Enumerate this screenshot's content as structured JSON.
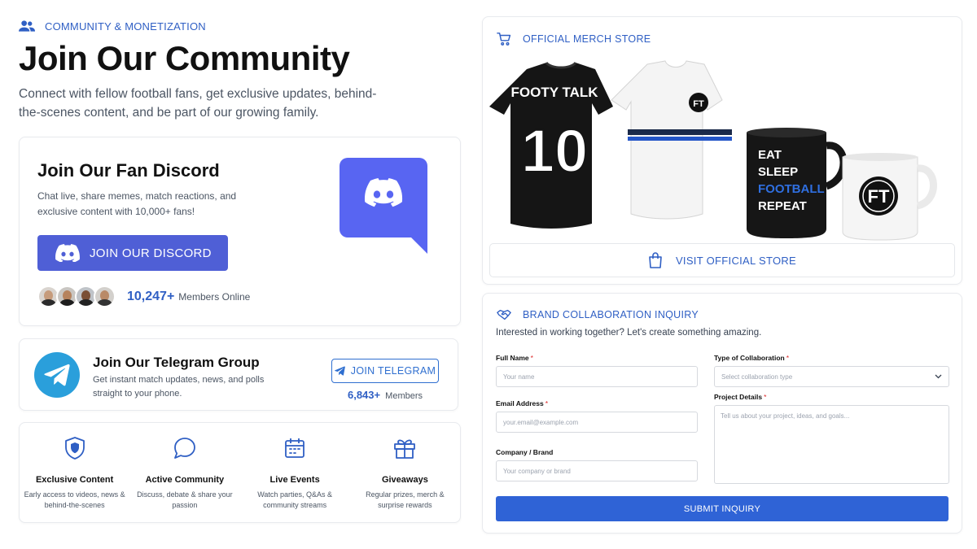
{
  "hero": {
    "eyebrow": "COMMUNITY & MONETIZATION",
    "eyebrow_icon": "users-icon",
    "title": "Join Our Community",
    "subtitle": "Connect with fellow football fans, get exclusive updates, behind-the-scenes content, and be part of our growing family."
  },
  "discord": {
    "title": "Join Our Fan Discord",
    "description": "Chat live, share memes, match reactions, and exclusive content with 10,000+ fans!",
    "button_label": "JOIN OUR DISCORD",
    "members_count": "10,247+",
    "members_label": "Members Online",
    "brand_color": "#5865f2"
  },
  "telegram": {
    "title": "Join Our Telegram Group",
    "description": "Get instant match updates, news, and polls straight to your phone.",
    "button_label": "JOIN TELEGRAM",
    "members_count": "6,843+",
    "members_label": "Members",
    "brand_color": "#2a9fdb"
  },
  "features": [
    {
      "icon": "shield-icon",
      "title": "Exclusive Content",
      "description": "Early access to videos, news & behind-the-scenes"
    },
    {
      "icon": "chat-bubble-icon",
      "title": "Active Community",
      "description": "Discuss, debate & share your passion"
    },
    {
      "icon": "calendar-icon",
      "title": "Live Events",
      "description": "Watch parties, Q&As & community streams"
    },
    {
      "icon": "gift-icon",
      "title": "Giveaways",
      "description": "Regular prizes, merch & surprise rewards"
    }
  ],
  "merch": {
    "heading": "OFFICIAL MERCH STORE",
    "heading_icon": "cart-icon",
    "jersey_text": "FOOTY TALK",
    "jersey_number": "10",
    "mug_lines": [
      "EAT",
      "SLEEP",
      "FOOTBALL",
      "REPEAT"
    ],
    "logo_text": "FT",
    "button_label": "VISIT OFFICIAL STORE",
    "button_icon": "shopping-bag-icon"
  },
  "collab": {
    "heading": "BRAND COLLABORATION INQUIRY",
    "heading_icon": "handshake-icon",
    "intro": "Interested in working together? Let's create something amazing.",
    "fields": {
      "full_name": {
        "label": "Full Name",
        "placeholder": "Your name"
      },
      "email": {
        "label": "Email Address",
        "placeholder": "your.email@example.com"
      },
      "company": {
        "label": "Company / Brand",
        "placeholder": "Your company or brand"
      },
      "type": {
        "label": "Type of Collaboration",
        "placeholder": "Select collaboration type"
      },
      "details": {
        "label": "Project Details",
        "placeholder": "Tell us about your project, ideas, and goals..."
      }
    },
    "required_mark": "*",
    "submit_label": "SUBMIT INQUIRY"
  },
  "colors": {
    "accent": "#2f5fc4",
    "discord_button": "#4f5fd6",
    "submit_button": "#2f63d6"
  }
}
